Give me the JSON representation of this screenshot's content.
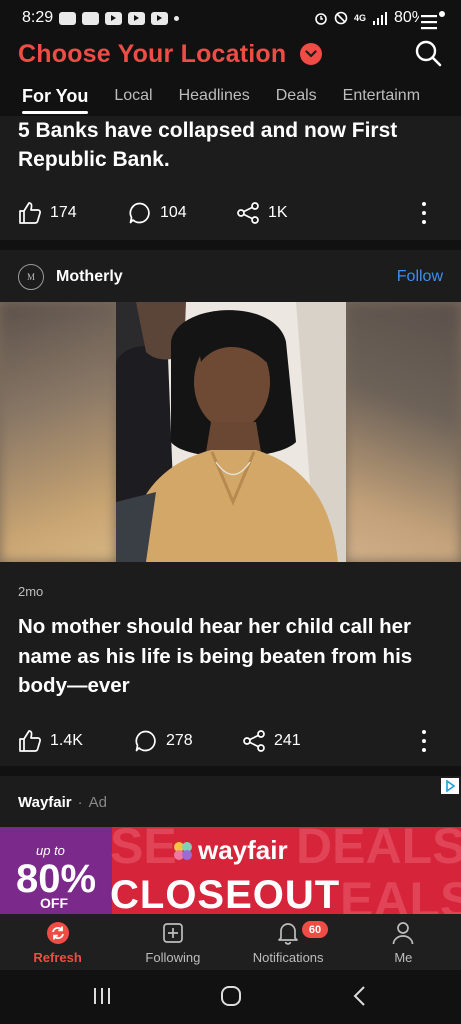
{
  "status_bar": {
    "time": "8:29",
    "network": "4G",
    "battery": "80%"
  },
  "header": {
    "title": "Choose Your Location"
  },
  "tabs": [
    {
      "label": "For You"
    },
    {
      "label": "Local"
    },
    {
      "label": "Headlines"
    },
    {
      "label": "Deals"
    },
    {
      "label": "Entertainm"
    }
  ],
  "feed": {
    "card1": {
      "title": "5 Banks have collapsed and now First Republic Bank.",
      "likes": "174",
      "comments": "104",
      "shares": "1K"
    },
    "card2": {
      "source": "Motherly",
      "source_logo": "M",
      "follow_label": "Follow",
      "age": "2mo",
      "headline": "No mother should hear her child call her name as his life is being beaten from his body—ever",
      "likes": "1.4K",
      "comments": "278",
      "shares": "241"
    },
    "ad": {
      "advertiser": "Wayfair",
      "separator": "·",
      "ad_label": "Ad",
      "up_to": "up to",
      "discount": "80%",
      "off": "OFF",
      "brand": "wayfair",
      "headline": "CLOSEOUT",
      "bg_words": [
        "SE",
        "DEALS",
        "EALS"
      ]
    }
  },
  "bottom_nav": [
    {
      "label": "Refresh",
      "icon": "refresh-icon"
    },
    {
      "label": "Following",
      "icon": "plus-square-icon"
    },
    {
      "label": "Notifications",
      "icon": "bell-icon",
      "badge": "60"
    },
    {
      "label": "Me",
      "icon": "person-icon"
    }
  ],
  "colors": {
    "accent": "#ef4c46",
    "link": "#3d8ef0",
    "background": "#111111",
    "card": "#1c1c1c"
  }
}
